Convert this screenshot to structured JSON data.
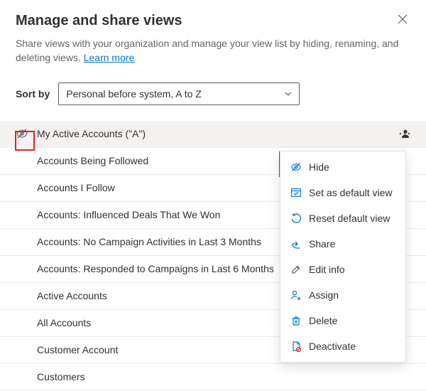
{
  "header": {
    "title": "Manage and share views",
    "description_prefix": "Share views with your organization and manage your view list by hiding, renaming, and deleting views. ",
    "learn_more": "Learn more"
  },
  "sort": {
    "label": "Sort by",
    "value": "Personal before system, A to Z"
  },
  "views": [
    {
      "label": "My Active Accounts (\"A\")",
      "personal": true,
      "selected": true,
      "hidden_icon": true
    },
    {
      "label": "Accounts Being Followed"
    },
    {
      "label": "Accounts I Follow"
    },
    {
      "label": "Accounts: Influenced Deals That We Won"
    },
    {
      "label": "Accounts: No Campaign Activities in Last 3 Months"
    },
    {
      "label": "Accounts: Responded to Campaigns in Last 6 Months"
    },
    {
      "label": "Active Accounts"
    },
    {
      "label": "All Accounts"
    },
    {
      "label": "Customer Account"
    },
    {
      "label": "Customers"
    }
  ],
  "menu": {
    "hide": "Hide",
    "set_default": "Set as default view",
    "reset_default": "Reset default view",
    "share": "Share",
    "edit_info": "Edit info",
    "assign": "Assign",
    "delete": "Delete",
    "deactivate": "Deactivate"
  }
}
